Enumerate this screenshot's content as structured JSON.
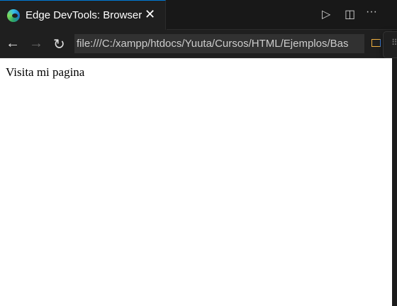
{
  "tab": {
    "title": "Edge DevTools: Browser",
    "close": "✕"
  },
  "actions": {
    "run": "▷",
    "split": "◫",
    "more": "···"
  },
  "toolbar": {
    "back": "←",
    "forward": "→",
    "reload": "↻",
    "url": "file:///C:/xampp/htdocs/Yuuta/Cursos/HTML/Ejemplos/Bas"
  },
  "float": {
    "grip": "⠿"
  },
  "page": {
    "text": "Visita mi pagina"
  },
  "colors": {
    "accent": "#0078d4",
    "background": "#1f1f1f"
  }
}
